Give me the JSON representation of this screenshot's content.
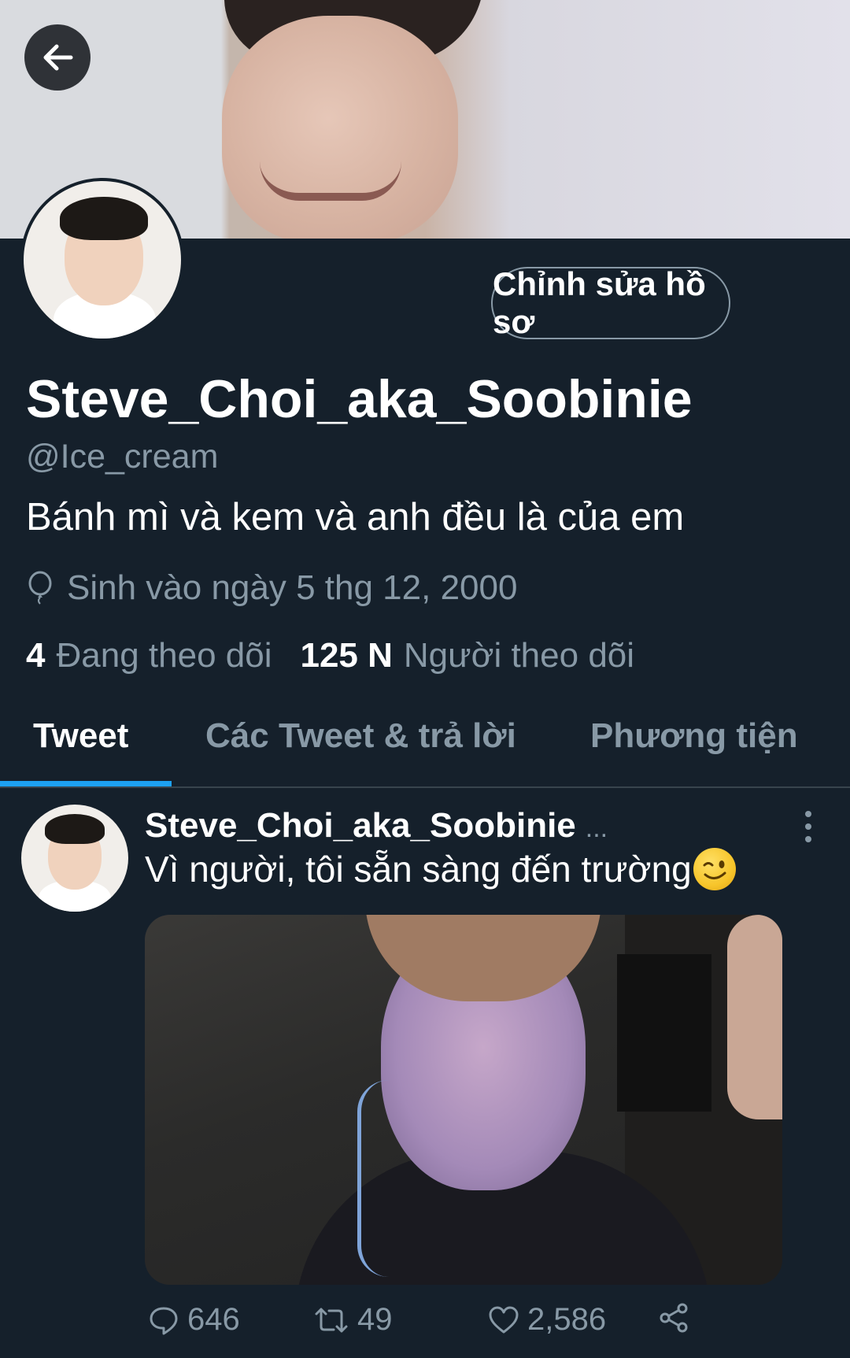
{
  "header": {
    "back_icon": "arrow-left-icon",
    "banner_alt": "profile banner photo"
  },
  "profile": {
    "edit_button_label": "Chỉnh sửa hồ sơ",
    "display_name": "Steve_Choi_aka_Soobinie",
    "handle": "@Ice_cream",
    "bio": "Bánh mì và kem và anh đều là của em",
    "birth_icon": "balloon-icon",
    "birth_text": "Sinh vào ngày 5 thg 12, 2000",
    "following_count": "4",
    "following_label": "Đang theo dõi",
    "followers_count": "125 N",
    "followers_label": "Người theo dõi"
  },
  "tabs": [
    {
      "label": "Tweet",
      "active": true
    },
    {
      "label": "Các Tweet & trả lời",
      "active": false
    },
    {
      "label": "Phương tiện",
      "active": false
    }
  ],
  "tweet": {
    "author": "Steve_Choi_aka_Soobinie",
    "author_suffix": "...",
    "text": "Vì người, tôi sẵn sàng đến trường",
    "emoji": "winking-face-emoji",
    "replies": "646",
    "retweets": "49",
    "likes": "2,586"
  },
  "colors": {
    "background": "#15202b",
    "secondary_text": "#8899a6",
    "accent": "#1da1f2",
    "divider": "#38444d"
  }
}
